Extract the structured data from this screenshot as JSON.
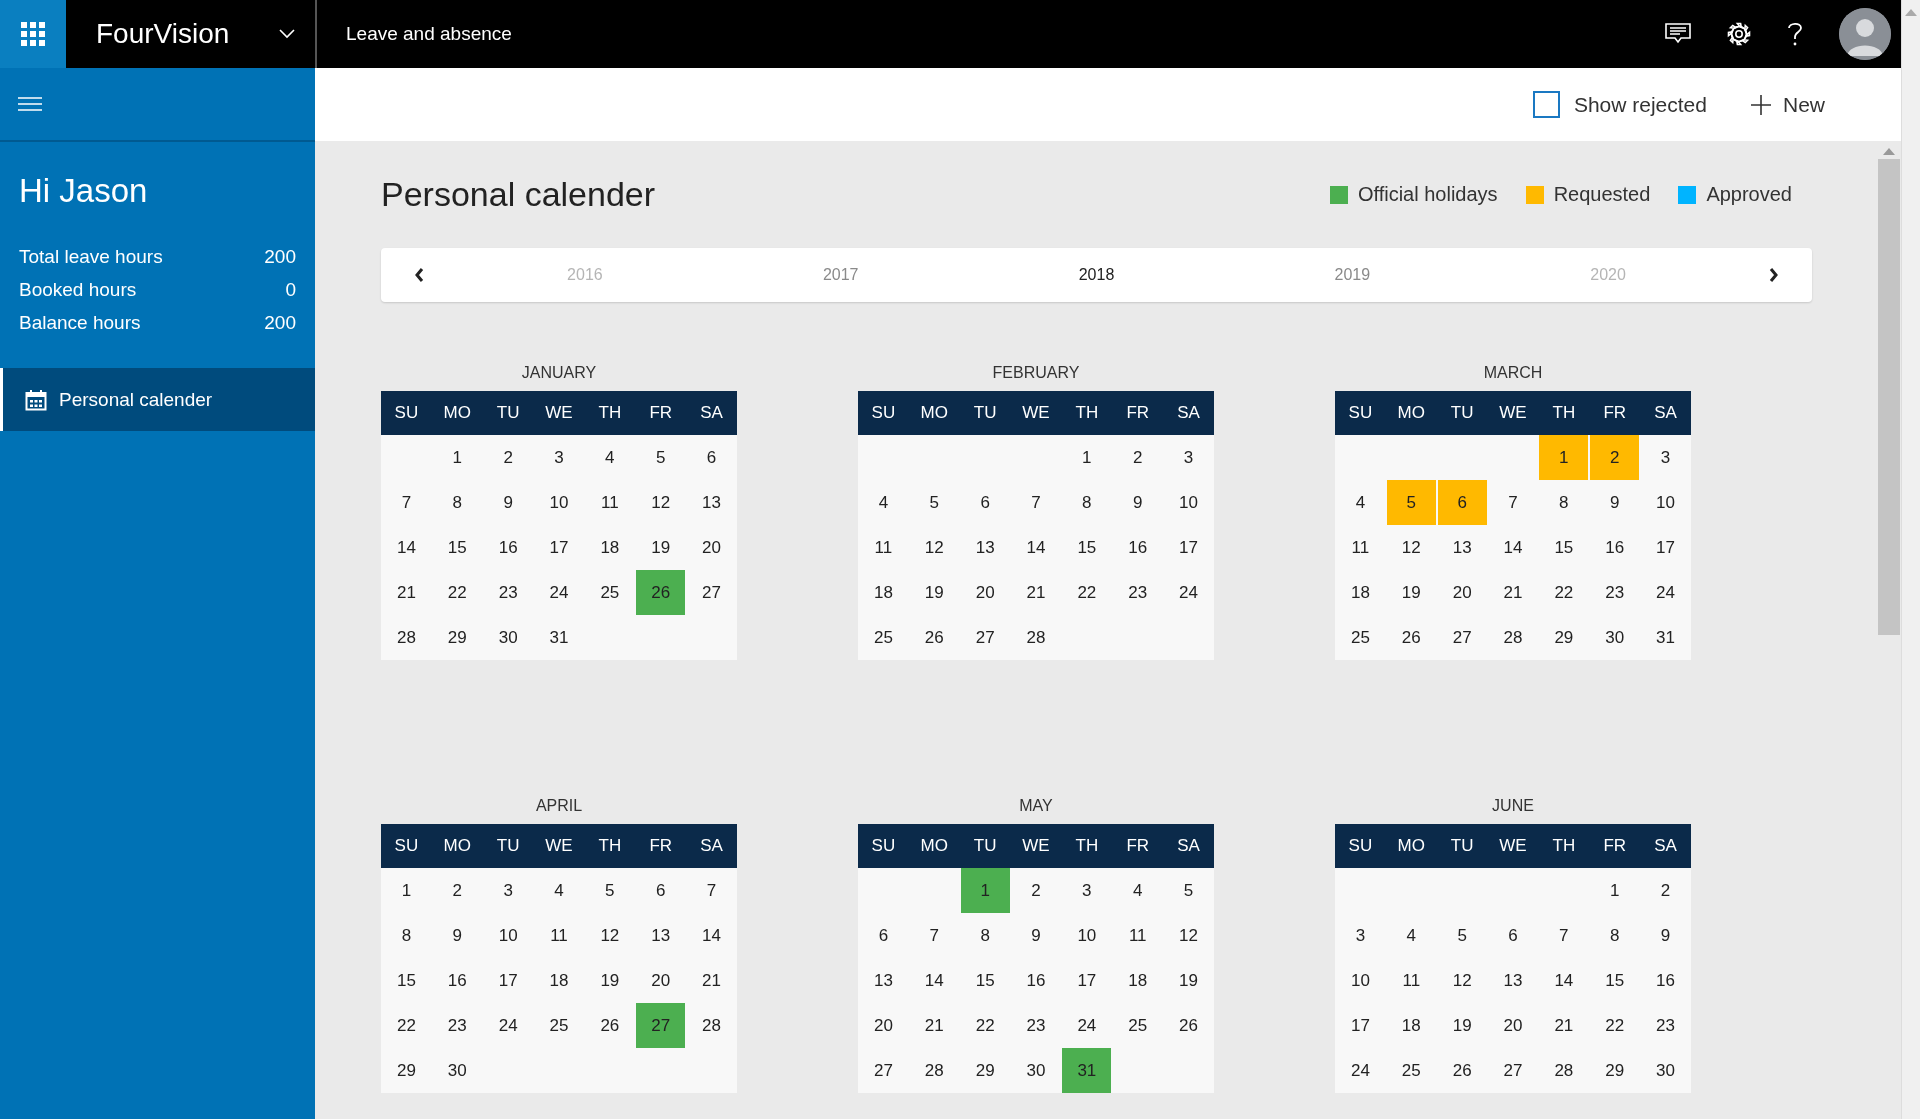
{
  "app_bar": {
    "app_name": "FourVision",
    "page_title": "Leave and absence"
  },
  "sidebar": {
    "greeting": "Hi Jason",
    "stats": [
      {
        "label": "Total leave hours",
        "value": "200"
      },
      {
        "label": "Booked hours",
        "value": "0"
      },
      {
        "label": "Balance hours",
        "value": "200"
      }
    ],
    "nav": [
      {
        "label": "Personal calender",
        "selected": true
      }
    ]
  },
  "toolbar": {
    "show_rejected": {
      "label": "Show rejected",
      "checked": false
    },
    "new_button": {
      "label": "New"
    }
  },
  "content": {
    "title": "Personal calender",
    "legend": [
      {
        "label": "Official holidays",
        "color": "#4caf50"
      },
      {
        "label": "Requested",
        "color": "#ffb900"
      },
      {
        "label": "Approved",
        "color": "#00b4ff"
      }
    ],
    "years": [
      {
        "label": "2016",
        "selected": false,
        "faded": true
      },
      {
        "label": "2017",
        "selected": false,
        "faded": false
      },
      {
        "label": "2018",
        "selected": true,
        "faded": false
      },
      {
        "label": "2019",
        "selected": false,
        "faded": false
      },
      {
        "label": "2020",
        "selected": false,
        "faded": true
      }
    ],
    "months": [
      {
        "name": "JANUARY",
        "weekdays": [
          "SU",
          "MO",
          "TU",
          "WE",
          "TH",
          "FR",
          "SA"
        ],
        "weeks": [
          {
            "kind": "first",
            "days": [
              "1",
              "2",
              "3",
              "4",
              "5",
              "6"
            ]
          },
          {
            "kind": "full",
            "days": [
              "7",
              "8",
              "9",
              "10",
              "11",
              "12",
              "13"
            ]
          },
          {
            "kind": "full",
            "days": [
              "14",
              "15",
              "16",
              "17",
              "18",
              "19",
              "20"
            ]
          },
          {
            "kind": "full",
            "days": [
              "21",
              "22",
              "23",
              "24",
              "25",
              {
                "day": "26",
                "color": "#4caf50"
              },
              "27"
            ]
          },
          {
            "kind": "last",
            "days": [
              "28",
              "29",
              "30",
              "31"
            ]
          }
        ]
      },
      {
        "name": "FEBRUARY",
        "weekdays": [
          "SU",
          "MO",
          "TU",
          "WE",
          "TH",
          "FR",
          "SA"
        ],
        "weeks": [
          {
            "kind": "first",
            "days": [
              "1",
              "2",
              "3"
            ]
          },
          {
            "kind": "full",
            "days": [
              "4",
              "5",
              "6",
              "7",
              "8",
              "9",
              "10"
            ]
          },
          {
            "kind": "full",
            "days": [
              "11",
              "12",
              "13",
              "14",
              "15",
              "16",
              "17"
            ]
          },
          {
            "kind": "full",
            "days": [
              "18",
              "19",
              "20",
              "21",
              "22",
              "23",
              "24"
            ]
          },
          {
            "kind": "last",
            "days": [
              "25",
              "26",
              "27",
              "28"
            ]
          }
        ]
      },
      {
        "name": "MARCH",
        "weekdays": [
          "SU",
          "MO",
          "TU",
          "WE",
          "TH",
          "FR",
          "SA"
        ],
        "weeks": [
          {
            "kind": "first",
            "days": [
              {
                "day": "1",
                "color": "#ffb900"
              },
              {
                "day": "2",
                "color": "#ffb900"
              },
              "3"
            ]
          },
          {
            "kind": "full",
            "days": [
              "4",
              {
                "day": "5",
                "color": "#ffb900"
              },
              {
                "day": "6",
                "color": "#ffb900"
              },
              "7",
              "8",
              "9",
              "10"
            ]
          },
          {
            "kind": "full",
            "days": [
              "11",
              "12",
              "13",
              "14",
              "15",
              "16",
              "17"
            ]
          },
          {
            "kind": "full",
            "days": [
              "18",
              "19",
              "20",
              "21",
              "22",
              "23",
              "24"
            ]
          },
          {
            "kind": "full",
            "days": [
              "25",
              "26",
              "27",
              "28",
              "29",
              "30",
              "31"
            ]
          }
        ]
      },
      {
        "name": "APRIL",
        "weekdays": [
          "SU",
          "MO",
          "TU",
          "WE",
          "TH",
          "FR",
          "SA"
        ],
        "weeks": [
          {
            "kind": "full",
            "days": [
              "1",
              "2",
              "3",
              "4",
              "5",
              "6",
              "7"
            ]
          },
          {
            "kind": "full",
            "days": [
              "8",
              "9",
              "10",
              "11",
              "12",
              "13",
              "14"
            ]
          },
          {
            "kind": "full",
            "days": [
              "15",
              "16",
              "17",
              "18",
              "19",
              "20",
              "21"
            ]
          },
          {
            "kind": "full",
            "days": [
              "22",
              "23",
              "24",
              "25",
              "26",
              {
                "day": "27",
                "color": "#4caf50"
              },
              "28"
            ]
          },
          {
            "kind": "last",
            "days": [
              "29",
              "30"
            ]
          }
        ]
      },
      {
        "name": "MAY",
        "weekdays": [
          "SU",
          "MO",
          "TU",
          "WE",
          "TH",
          "FR",
          "SA"
        ],
        "weeks": [
          {
            "kind": "first",
            "days": [
              {
                "day": "1",
                "color": "#4caf50"
              },
              "2",
              "3",
              "4",
              "5"
            ]
          },
          {
            "kind": "full",
            "days": [
              "6",
              "7",
              "8",
              "9",
              "10",
              "11",
              "12"
            ]
          },
          {
            "kind": "full",
            "days": [
              "13",
              "14",
              "15",
              "16",
              "17",
              "18",
              "19"
            ]
          },
          {
            "kind": "full",
            "days": [
              "20",
              "21",
              "22",
              "23",
              "24",
              "25",
              "26"
            ]
          },
          {
            "kind": "last",
            "days": [
              "27",
              "28",
              "29",
              "30",
              {
                "day": "31",
                "color": "#4caf50"
              }
            ]
          }
        ]
      },
      {
        "name": "JUNE",
        "weekdays": [
          "SU",
          "MO",
          "TU",
          "WE",
          "TH",
          "FR",
          "SA"
        ],
        "weeks": [
          {
            "kind": "first",
            "days": [
              "1",
              "2"
            ]
          },
          {
            "kind": "full",
            "days": [
              "3",
              "4",
              "5",
              "6",
              "7",
              "8",
              "9"
            ]
          },
          {
            "kind": "full",
            "days": [
              "10",
              "11",
              "12",
              "13",
              "14",
              "15",
              "16"
            ]
          },
          {
            "kind": "full",
            "days": [
              "17",
              "18",
              "19",
              "20",
              "21",
              "22",
              "23"
            ]
          },
          {
            "kind": "full",
            "days": [
              "24",
              "25",
              "26",
              "27",
              "28",
              "29",
              "30"
            ]
          }
        ]
      }
    ]
  }
}
